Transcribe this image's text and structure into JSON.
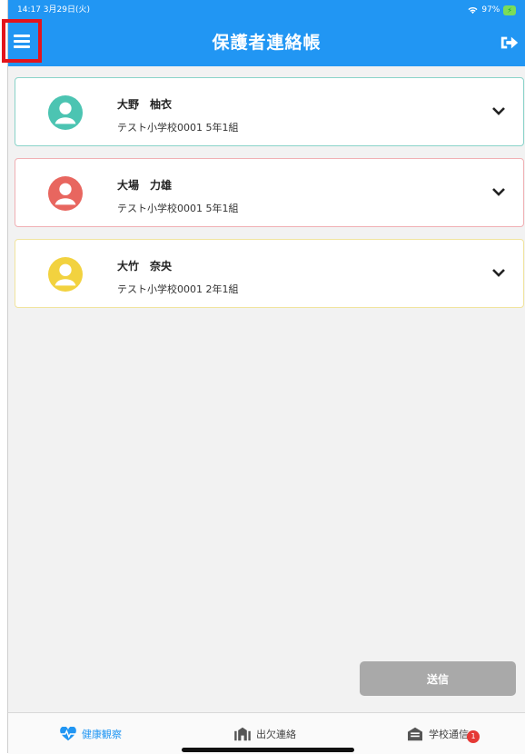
{
  "status_bar": {
    "time": "14:17 3月29日(火)",
    "wifi": "wifi-icon",
    "battery": "97%"
  },
  "header": {
    "title": "保護者連絡帳",
    "menu_icon": "hamburger-menu-icon",
    "logout_icon": "logout-icon"
  },
  "children": [
    {
      "name": "大野　柚衣",
      "school": "テスト小学校0001 5年1組",
      "color": "#4cc4b2"
    },
    {
      "name": "大場　力雄",
      "school": "テスト小学校0001 5年1組",
      "color": "#e8665f"
    },
    {
      "name": "大竹　奈央",
      "school": "テスト小学校0001 2年1組",
      "color": "#f2d23f"
    }
  ],
  "send_button": {
    "label": "送信"
  },
  "tabs": [
    {
      "label": "健康観察",
      "icon": "heartbeat-icon",
      "active": true
    },
    {
      "label": "出欠連絡",
      "icon": "attendance-icon",
      "active": false
    },
    {
      "label": "学校通信",
      "icon": "newsletter-icon",
      "active": false,
      "badge": "1"
    }
  ],
  "colors": {
    "accent": "#2196f3",
    "highlight": "#e3141c"
  }
}
